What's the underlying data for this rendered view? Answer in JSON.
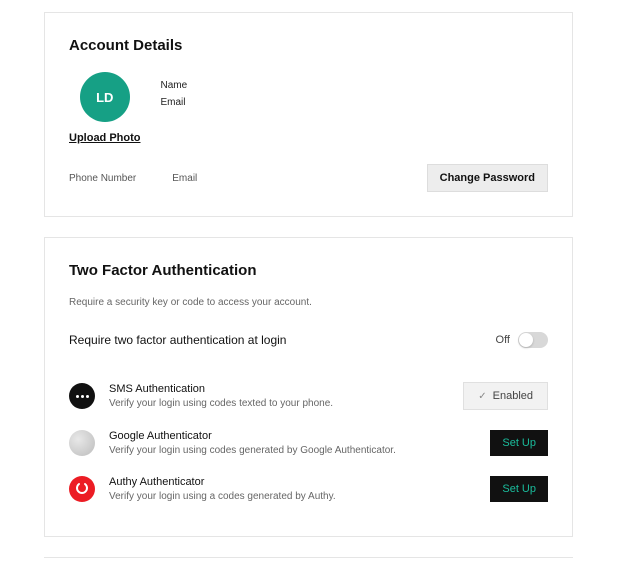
{
  "account": {
    "title": "Account Details",
    "avatar_initials": "LD",
    "name_label": "Name",
    "email_label": "Email",
    "upload_label": "Upload Photo",
    "phone_field_label": "Phone Number",
    "email_field_label": "Email",
    "change_password_label": "Change Password"
  },
  "twofa": {
    "title": "Two Factor Authentication",
    "subtitle": "Require a security key or code to access your account.",
    "require_label": "Require two factor authentication at login",
    "toggle_state": "Off",
    "enabled_label": "Enabled",
    "setup_label": "Set Up",
    "methods": [
      {
        "name": "SMS Authentication",
        "desc": "Verify your login using codes texted to your phone.",
        "status": "enabled"
      },
      {
        "name": "Google Authenticator",
        "desc": "Verify your login using codes generated by Google Authenticator.",
        "status": "setup"
      },
      {
        "name": "Authy Authenticator",
        "desc": "Verify your login using a codes generated by Authy.",
        "status": "setup"
      }
    ]
  }
}
